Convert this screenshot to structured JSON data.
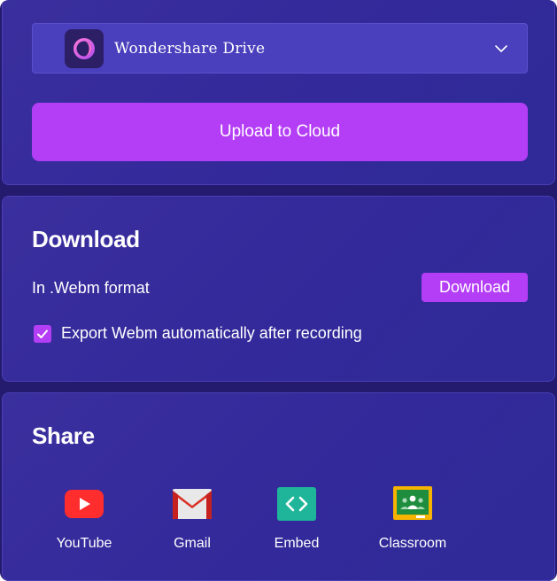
{
  "cloud": {
    "drive_name": "Wondershare Drive",
    "upload_label": "Upload to Cloud"
  },
  "download": {
    "title": "Download",
    "format_label": "In .Webm format",
    "button_label": "Download",
    "auto_export_label": "Export Webm automatically after recording",
    "auto_export_checked": true
  },
  "share": {
    "title": "Share",
    "items": [
      {
        "label": "YouTube",
        "icon": "youtube-icon"
      },
      {
        "label": "Gmail",
        "icon": "gmail-icon"
      },
      {
        "label": "Embed",
        "icon": "embed-icon"
      },
      {
        "label": "Classroom",
        "icon": "classroom-icon"
      }
    ]
  },
  "colors": {
    "panel_bg": "#3b2f9e",
    "accent": "#b43df6",
    "select_bg": "#4a3fbc"
  }
}
